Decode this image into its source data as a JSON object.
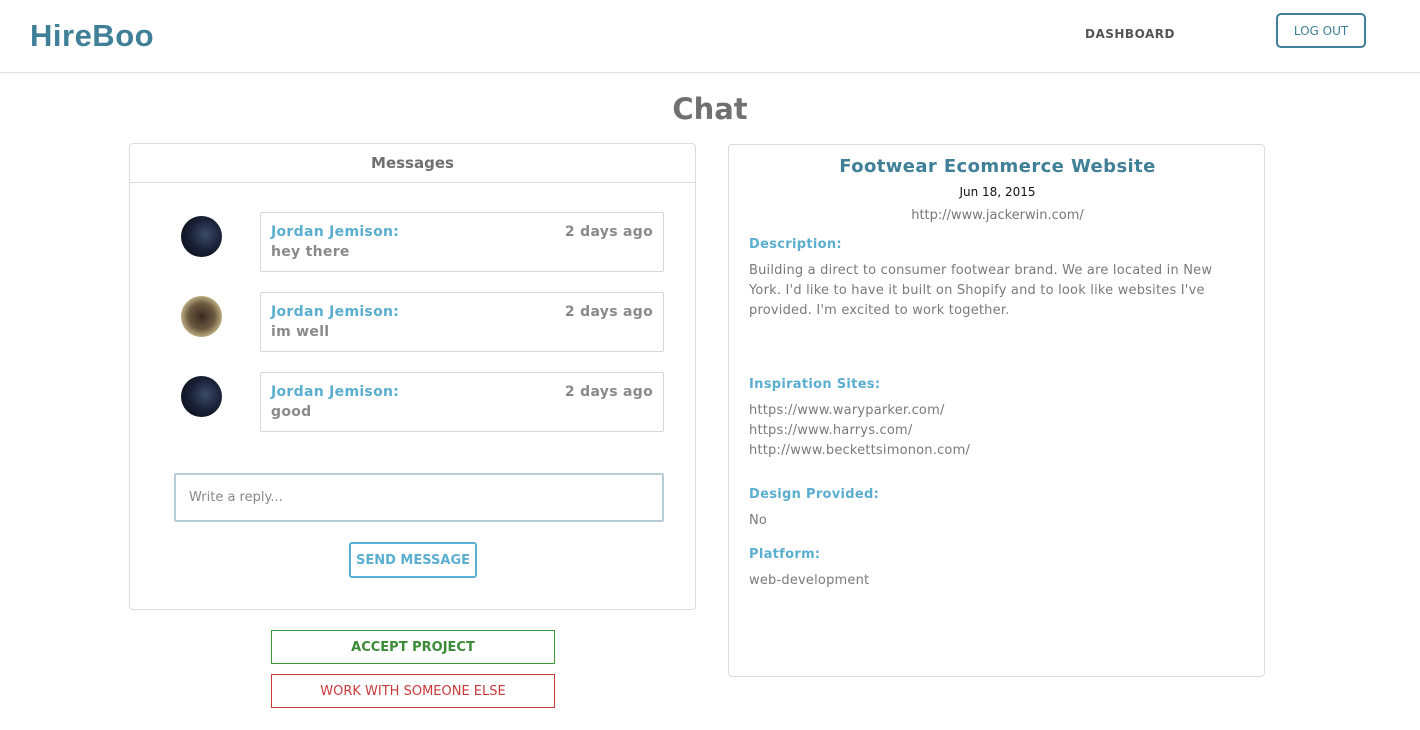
{
  "header": {
    "brand": "HireBoo",
    "nav_dashboard": "DASHBOARD",
    "logout_label": "LOG OUT"
  },
  "page": {
    "title": "Chat"
  },
  "messages": {
    "header": "Messages",
    "items": [
      {
        "author": "Jordan Jemison:",
        "time": "2 days ago",
        "text": "hey there",
        "avatar": "night-sky-avatar"
      },
      {
        "author": "Jordan Jemison:",
        "time": "2 days ago",
        "text": "im well",
        "avatar": "person-photo-avatar"
      },
      {
        "author": "Jordan Jemison:",
        "time": "2 days ago",
        "text": "good",
        "avatar": "night-sky-avatar"
      }
    ],
    "reply_placeholder": "Write a reply...",
    "send_label": "SEND MESSAGE"
  },
  "actions": {
    "accept_label": "ACCEPT PROJECT",
    "reject_label": "WORK WITH SOMEONE ELSE"
  },
  "project": {
    "title": "Footwear Ecommerce Website",
    "date": "Jun 18, 2015",
    "url": "http://www.jackerwin.com/",
    "description_label": "Description:",
    "description_lines": [
      "Building a direct to consumer footwear brand. We are located in New",
      "York. I'd like to have it built on Shopify and to look like websites I've",
      "provided. I'm excited to work together."
    ],
    "inspiration_label": "Inspiration Sites:",
    "inspiration_sites": [
      "https://www.waryparker.com/",
      "https://www.harrys.com/",
      "http://www.beckettsimonon.com/"
    ],
    "design_label": "Design Provided:",
    "design_value": "No",
    "platform_label": "Platform:",
    "platform_value": "web-development"
  },
  "colors": {
    "brand": "#3f7f97",
    "accent": "#5aaed0",
    "accept": "#3a8a3a",
    "reject": "#c93a3a"
  }
}
